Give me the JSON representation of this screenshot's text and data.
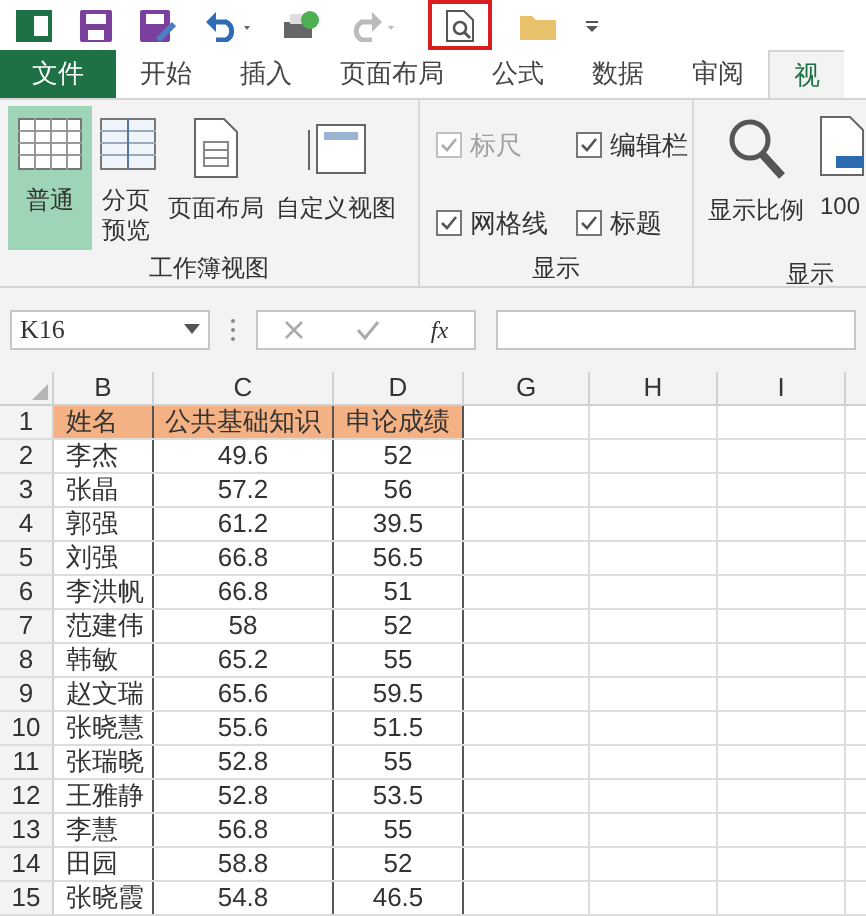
{
  "tabs": [
    {
      "label": "文件",
      "kind": "file",
      "selected": false
    },
    {
      "label": "开始",
      "kind": "tab",
      "selected": false
    },
    {
      "label": "插入",
      "kind": "tab",
      "selected": false
    },
    {
      "label": "页面布局",
      "kind": "tab",
      "selected": false
    },
    {
      "label": "公式",
      "kind": "tab",
      "selected": false
    },
    {
      "label": "数据",
      "kind": "tab",
      "selected": false
    },
    {
      "label": "审阅",
      "kind": "tab",
      "selected": false
    },
    {
      "label": "视",
      "kind": "tab",
      "selected": true
    }
  ],
  "ribbon": {
    "workbook_views": {
      "label": "工作簿视图",
      "items": [
        {
          "label": "普通",
          "kind": "normal",
          "selected": true
        },
        {
          "label": "分页预览",
          "kind": "pagebreak",
          "selected": false
        },
        {
          "label": "页面布局",
          "kind": "layout",
          "selected": false
        },
        {
          "label": "自定义视图",
          "kind": "custom",
          "selected": false
        }
      ]
    },
    "show": {
      "label": "显示",
      "checks": [
        {
          "label": "标尺",
          "checked": true,
          "disabled": true
        },
        {
          "label": "编辑栏",
          "checked": true,
          "disabled": false
        },
        {
          "label": "网格线",
          "checked": true,
          "disabled": false
        },
        {
          "label": "标题",
          "checked": true,
          "disabled": false
        }
      ]
    },
    "zoom": {
      "label": "显示",
      "items": [
        {
          "label": "显示比例",
          "kind": "zoom"
        },
        {
          "label": "100",
          "kind": "hundred"
        }
      ]
    }
  },
  "formula_bar": {
    "name_box": "K16",
    "fx": "fx"
  },
  "sheet": {
    "columns": [
      "B",
      "C",
      "D",
      "G",
      "H",
      "I"
    ],
    "rows": [
      {
        "num": "1",
        "cells": [
          "姓名",
          "公共基础知识",
          "申论成绩"
        ],
        "header": true
      },
      {
        "num": "2",
        "cells": [
          "李杰",
          "49.6",
          "52"
        ],
        "header": false
      },
      {
        "num": "3",
        "cells": [
          "张晶",
          "57.2",
          "56"
        ],
        "header": false
      },
      {
        "num": "4",
        "cells": [
          "郭强",
          "61.2",
          "39.5"
        ],
        "header": false
      },
      {
        "num": "5",
        "cells": [
          "刘强",
          "66.8",
          "56.5"
        ],
        "header": false
      },
      {
        "num": "6",
        "cells": [
          "李洪帆",
          "66.8",
          "51"
        ],
        "header": false
      },
      {
        "num": "7",
        "cells": [
          "范建伟",
          "58",
          "52"
        ],
        "header": false
      },
      {
        "num": "8",
        "cells": [
          "韩敏",
          "65.2",
          "55"
        ],
        "header": false
      },
      {
        "num": "9",
        "cells": [
          "赵文瑞",
          "65.6",
          "59.5"
        ],
        "header": false
      },
      {
        "num": "10",
        "cells": [
          "张晓慧",
          "55.6",
          "51.5"
        ],
        "header": false
      },
      {
        "num": "11",
        "cells": [
          "张瑞晓",
          "52.8",
          "55"
        ],
        "header": false
      },
      {
        "num": "12",
        "cells": [
          "王雅静",
          "52.8",
          "53.5"
        ],
        "header": false
      },
      {
        "num": "13",
        "cells": [
          "李慧",
          "56.8",
          "55"
        ],
        "header": false
      },
      {
        "num": "14",
        "cells": [
          "田园",
          "58.8",
          "52"
        ],
        "header": false
      },
      {
        "num": "15",
        "cells": [
          "张晓霞",
          "54.8",
          "46.5"
        ],
        "header": false
      }
    ]
  }
}
